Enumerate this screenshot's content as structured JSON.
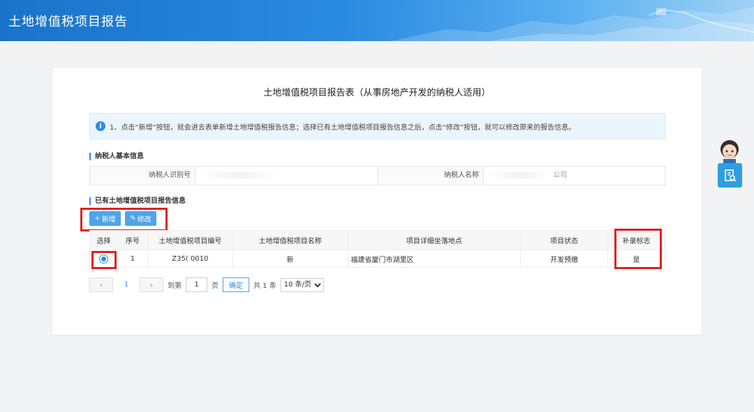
{
  "header": {
    "title": "土地增值税项目报告"
  },
  "form": {
    "title": "土地增值税项目报告表（从事房地产开发的纳税人适用）",
    "notice": "1、点击“新增”按钮，就会进去表单新增土地增值税报告信息；选择已有土地增值税项目报告信息之后，点击“修改”按钮，就可以修改原来的报告信息。"
  },
  "basic_info": {
    "section_title": "纳税人基本信息",
    "taxpayer_id_label": "纳税人识别号",
    "taxpayer_id_value": "",
    "taxpayer_name_label": "纳税人名称",
    "taxpayer_name_value": "公司"
  },
  "report_info": {
    "section_title": "已有土地增值税项目报告信息",
    "add_button": "新增",
    "edit_button": "修改"
  },
  "table": {
    "headers": [
      "选择",
      "序号",
      "土地增值税项目编号",
      "土地增值税项目名称",
      "项目详细坐落地点",
      "项目状态",
      "补录标志"
    ],
    "rows": [
      {
        "index": "1",
        "code": "Z35( 0010",
        "name": "新",
        "location": "福建省厦门市湖里区",
        "status": "开发预缴",
        "flag": "是",
        "selected": true
      }
    ]
  },
  "pager": {
    "current_page": "1",
    "goto_label": "到第",
    "page_input": "1",
    "page_suffix": "页",
    "confirm": "确定",
    "total": "共 1 条",
    "page_size": "10 条/页"
  },
  "colors": {
    "primary": "#2f8be0",
    "header_bg": "#1a73c9",
    "highlight": "#e02020"
  }
}
